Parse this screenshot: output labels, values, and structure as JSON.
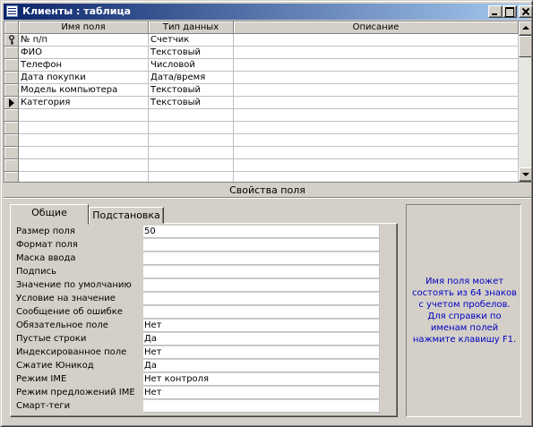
{
  "window": {
    "title": "Клиенты : таблица"
  },
  "grid": {
    "columns": [
      "Имя поля",
      "Тип данных",
      "Описание"
    ],
    "rows": [
      {
        "name": "№ п/п",
        "type": "Счетчик",
        "desc": "",
        "marker": "key-icon"
      },
      {
        "name": "ФИО",
        "type": "Текстовый",
        "desc": "",
        "marker": ""
      },
      {
        "name": "Телефон",
        "type": "Числовой",
        "desc": "",
        "marker": ""
      },
      {
        "name": "Дата покупки",
        "type": "Дата/время",
        "desc": "",
        "marker": ""
      },
      {
        "name": "Модель компьютера",
        "type": "Текстовый",
        "desc": "",
        "marker": ""
      },
      {
        "name": "Категория",
        "type": "Текстовый",
        "desc": "",
        "marker": "current-row-icon"
      }
    ],
    "empty_rows": 6
  },
  "properties": {
    "section_label": "Свойства поля",
    "tabs": [
      {
        "label": "Общие",
        "active": true
      },
      {
        "label": "Подстановка",
        "active": false
      }
    ],
    "items": [
      {
        "label": "Размер поля",
        "value": "50"
      },
      {
        "label": "Формат поля",
        "value": ""
      },
      {
        "label": "Маска ввода",
        "value": ""
      },
      {
        "label": "Подпись",
        "value": ""
      },
      {
        "label": "Значение по умолчанию",
        "value": ""
      },
      {
        "label": "Условие на значение",
        "value": ""
      },
      {
        "label": "Сообщение об ошибке",
        "value": ""
      },
      {
        "label": "Обязательное поле",
        "value": "Нет"
      },
      {
        "label": "Пустые строки",
        "value": "Да"
      },
      {
        "label": "Индексированное поле",
        "value": "Нет"
      },
      {
        "label": "Сжатие Юникод",
        "value": "Да"
      },
      {
        "label": "Режим IME",
        "value": "Нет контроля"
      },
      {
        "label": "Режим предложений IME",
        "value": "Нет"
      },
      {
        "label": "Смарт-теги",
        "value": ""
      }
    ],
    "help_text": "Имя поля может состоять из 64 знаков с учетом пробелов. Для справки по именам полей нажмите клавишу F1."
  },
  "colors": {
    "titlebar_start": "#0a246a",
    "titlebar_end": "#a6caf0",
    "help_text": "#0000c0",
    "face": "#d4d0c8"
  }
}
